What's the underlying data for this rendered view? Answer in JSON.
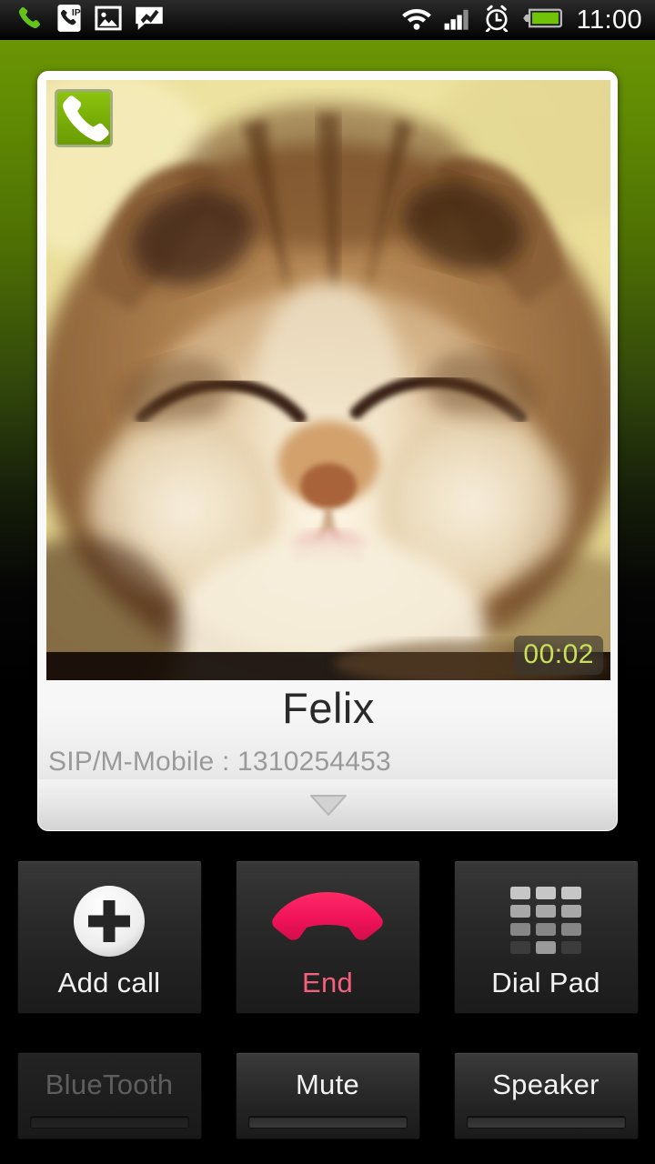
{
  "statusbar": {
    "time": "11:00",
    "left_icons": [
      {
        "name": "phone-call-icon",
        "label": "Ongoing call"
      },
      {
        "name": "ip-call-icon",
        "label": "IP call"
      },
      {
        "name": "image-icon",
        "label": "Screenshot captured"
      },
      {
        "name": "message-icon",
        "label": "New message"
      }
    ],
    "right_icons": [
      {
        "name": "wifi-icon",
        "label": "Wi-Fi"
      },
      {
        "name": "signal-icon",
        "label": "Signal strength"
      },
      {
        "name": "alarm-icon",
        "label": "Alarm set"
      },
      {
        "name": "battery-icon",
        "label": "Battery"
      }
    ]
  },
  "call_card": {
    "badge_icon": "phone-handset-icon",
    "timer": "00:02",
    "contact_name": "Felix",
    "contact_number": "SIP/M-Mobile : 1310254453",
    "handle_icon": "chevron-down-triangle-icon",
    "photo_alt": "Contact photo of a sleeping tabby kitten"
  },
  "primary_actions": [
    {
      "name": "add-call-button",
      "label": "Add call",
      "icon": "plus-circle-icon",
      "style": "normal",
      "enabled": true
    },
    {
      "name": "end-call-button",
      "label": "End",
      "icon": "end-call-icon",
      "style": "danger",
      "enabled": true
    },
    {
      "name": "dial-pad-button",
      "label": "Dial Pad",
      "icon": "dial-pad-icon",
      "style": "normal",
      "enabled": true
    }
  ],
  "secondary_actions": [
    {
      "name": "bluetooth-toggle",
      "label": "BlueTooth",
      "enabled": false,
      "active": false
    },
    {
      "name": "mute-toggle",
      "label": "Mute",
      "enabled": true,
      "active": false
    },
    {
      "name": "speaker-toggle",
      "label": "Speaker",
      "enabled": true,
      "active": false
    }
  ],
  "colors": {
    "accent_green": "#79ae06",
    "backdrop_green": "#6b9504",
    "end_red": "#f0175a",
    "end_label": "#f4607c",
    "timer_green": "#c8e05a",
    "card_white": "#fdfdfd"
  }
}
